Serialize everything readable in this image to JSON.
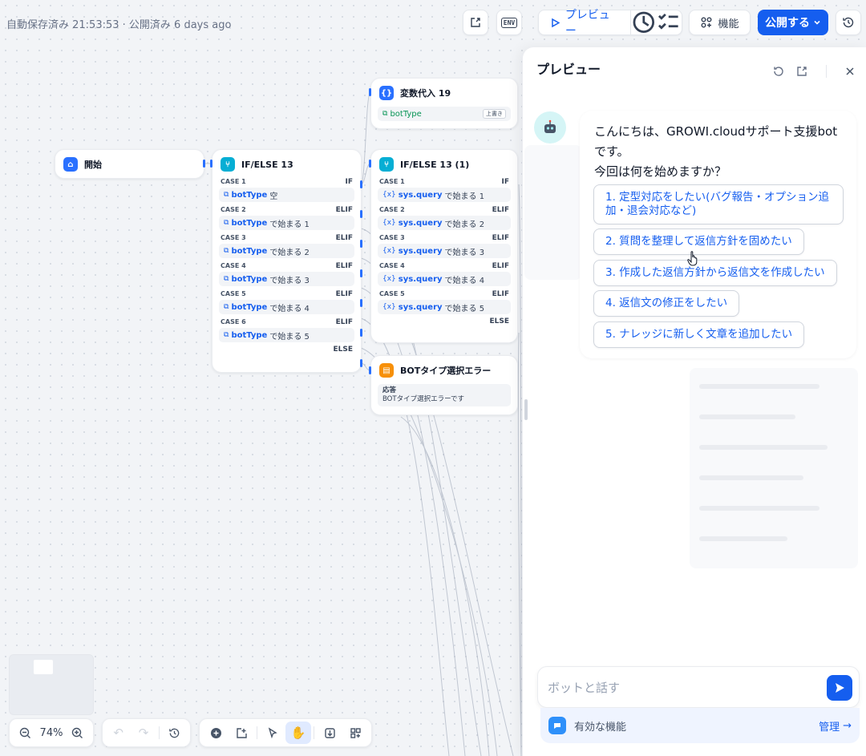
{
  "header": {
    "save_status": "自動保存済み 21:53:53 · 公開済み 6 days ago",
    "env_label": "ENV",
    "preview_label": "プレビュー",
    "features_label": "機能",
    "publish_label": "公開する"
  },
  "nodes": {
    "start": {
      "title": "開始"
    },
    "ifelse13": {
      "title": "IF/ELSE 13",
      "cases": [
        {
          "case": "CASE 1",
          "kw": "IF",
          "var": "botType",
          "op": "空"
        },
        {
          "case": "CASE 2",
          "kw": "ELIF",
          "var": "botType",
          "op": "で始まる 1"
        },
        {
          "case": "CASE 3",
          "kw": "ELIF",
          "var": "botType",
          "op": "で始まる 2"
        },
        {
          "case": "CASE 4",
          "kw": "ELIF",
          "var": "botType",
          "op": "で始まる 3"
        },
        {
          "case": "CASE 5",
          "kw": "ELIF",
          "var": "botType",
          "op": "で始まる 4"
        },
        {
          "case": "CASE 6",
          "kw": "ELIF",
          "var": "botType",
          "op": "で始まる 5"
        }
      ],
      "else_label": "ELSE"
    },
    "var19": {
      "title": "変数代入 19",
      "var": "botType",
      "badge": "上書き"
    },
    "ifelse13b": {
      "title": "IF/ELSE 13 (1)",
      "cases": [
        {
          "case": "CASE 1",
          "kw": "IF",
          "var": "sys.query",
          "op": "で始まる 1"
        },
        {
          "case": "CASE 2",
          "kw": "ELIF",
          "var": "sys.query",
          "op": "で始まる 2"
        },
        {
          "case": "CASE 3",
          "kw": "ELIF",
          "var": "sys.query",
          "op": "で始まる 3"
        },
        {
          "case": "CASE 4",
          "kw": "ELIF",
          "var": "sys.query",
          "op": "で始まる 4"
        },
        {
          "case": "CASE 5",
          "kw": "ELIF",
          "var": "sys.query",
          "op": "で始まる 5"
        }
      ],
      "else_label": "ELSE"
    },
    "boterror": {
      "title": "BOTタイプ選択エラー",
      "label": "応答",
      "text": "BOTタイプ選択エラーです"
    }
  },
  "zoom": {
    "level": "74%"
  },
  "preview": {
    "title": "プレビュー",
    "message": "こんにちは、GROWI.cloudサポート支援botです。\n今回は何を始めますか？",
    "options": [
      "1. 定型対応をしたい(バグ報告・オプション追加・退会対応など)",
      "2. 質問を整理して返信方針を固めたい",
      "3. 作成した返信方針から返信文を作成したい",
      "4. 返信文の修正をしたい",
      "5. ナレッジに新しく文章を追加したい"
    ],
    "input_placeholder": "ボットと話す",
    "features_label": "有効な機能",
    "manage_label": "管理"
  },
  "colors": {
    "accent": "#155eef",
    "node_blue": "#2970ff",
    "node_cyan": "#06aed4",
    "node_orange": "#f79009"
  }
}
